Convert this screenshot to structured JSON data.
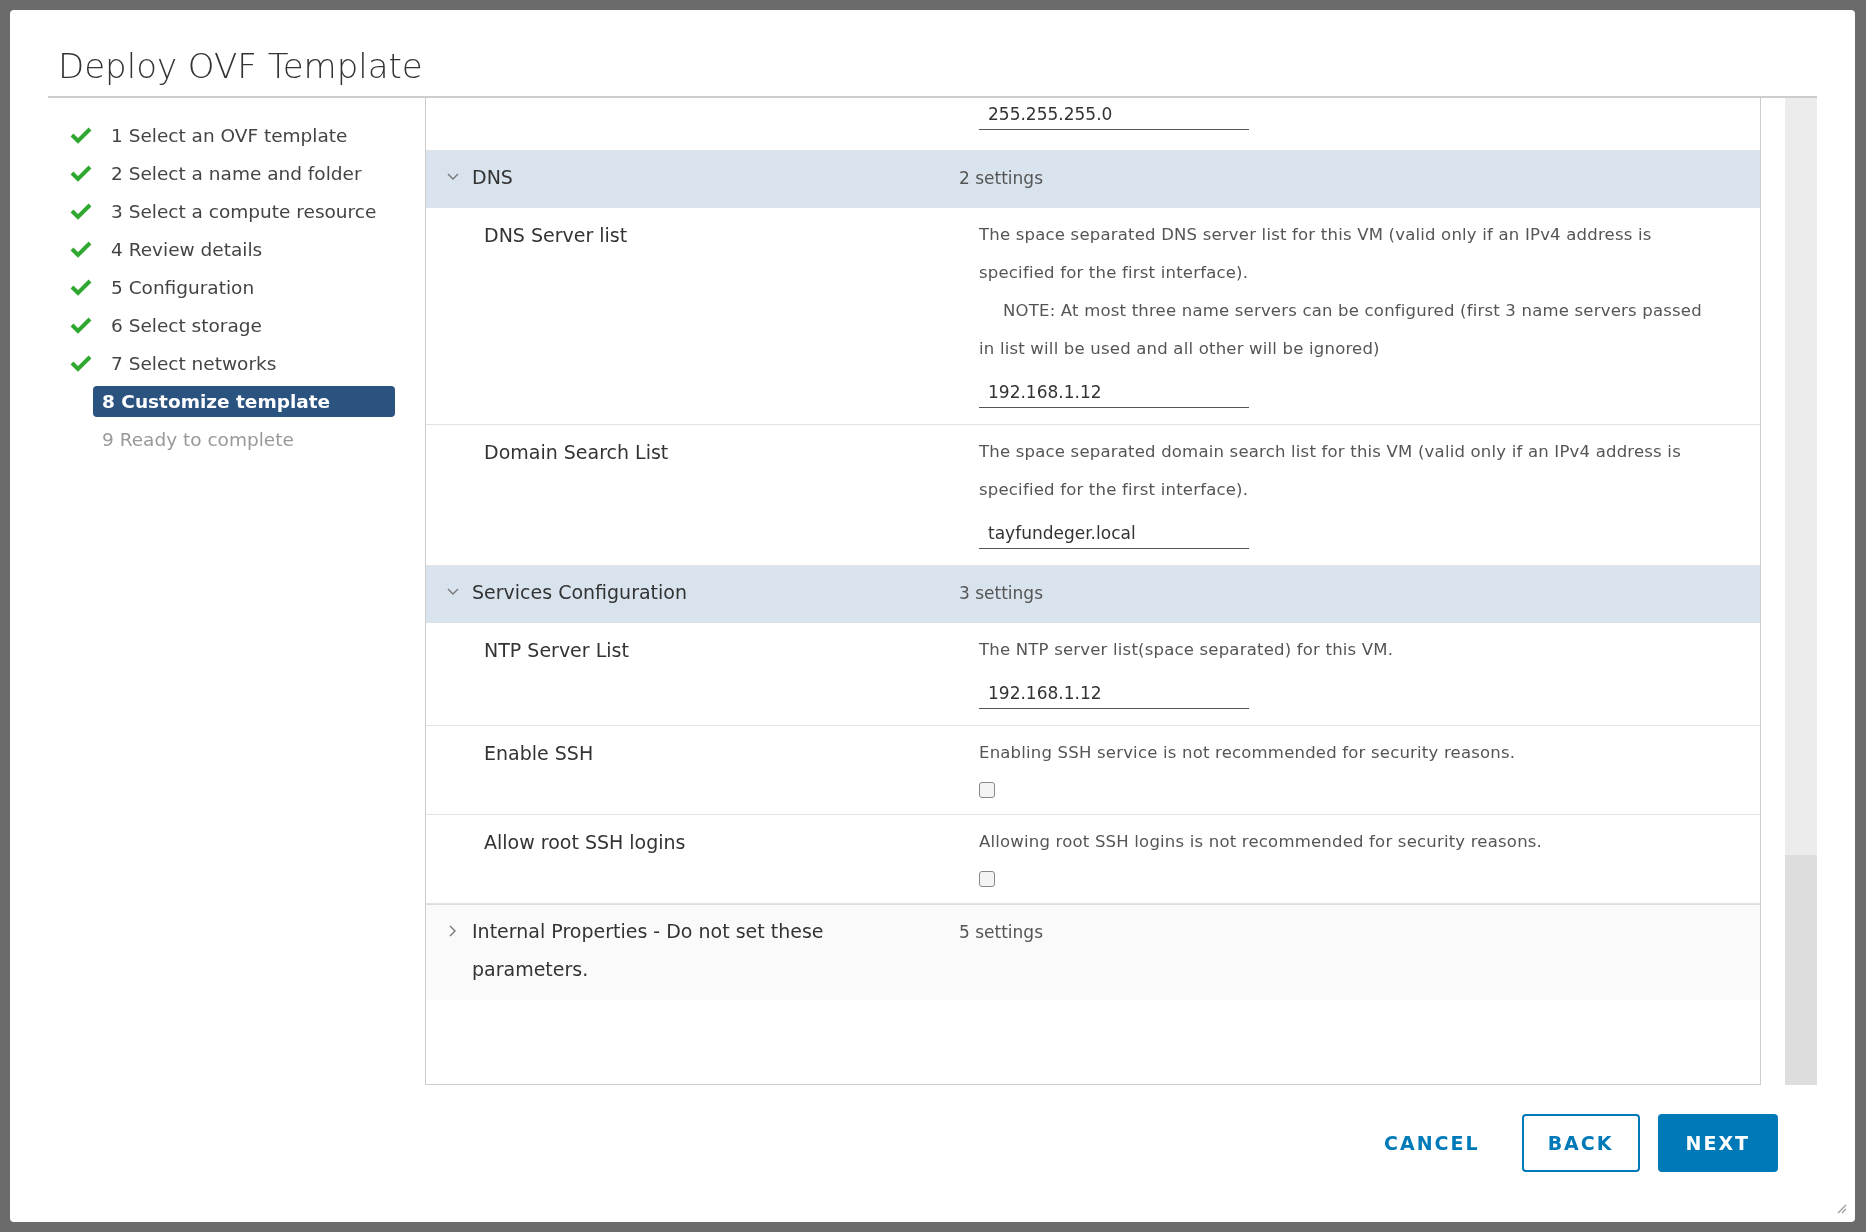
{
  "window": {
    "title": "Deploy OVF Template"
  },
  "steps": [
    {
      "label": "1 Select an OVF template",
      "completed": true,
      "selected": false,
      "disabled": false
    },
    {
      "label": "2 Select a name and folder",
      "completed": true,
      "selected": false,
      "disabled": false
    },
    {
      "label": "3 Select a compute resource",
      "completed": true,
      "selected": false,
      "disabled": false
    },
    {
      "label": "4 Review details",
      "completed": true,
      "selected": false,
      "disabled": false
    },
    {
      "label": "5 Configuration",
      "completed": true,
      "selected": false,
      "disabled": false
    },
    {
      "label": "6 Select storage",
      "completed": true,
      "selected": false,
      "disabled": false
    },
    {
      "label": "7 Select networks",
      "completed": true,
      "selected": false,
      "disabled": false
    },
    {
      "label": "8 Customize template",
      "completed": false,
      "selected": true,
      "disabled": false
    },
    {
      "label": "9 Ready to complete",
      "completed": false,
      "selected": false,
      "disabled": true
    }
  ],
  "top_field": {
    "value": "255.255.255.0"
  },
  "sections": [
    {
      "title": "DNS",
      "count": "2 settings",
      "expanded": true,
      "rows": [
        {
          "kind": "field",
          "label": "DNS Server list",
          "description": [
            "The space separated DNS server list for this VM (valid only if an IPv4 address is specified for the first interface).",
            "NOTE: At most three name servers can be configured (first 3 name servers passed in list will be used and all other will be ignored)"
          ],
          "value": "192.168.1.12"
        },
        {
          "kind": "field",
          "label": "Domain Search List",
          "description": [
            "The space separated domain search list for this VM (valid only if an IPv4 address is specified for the first interface)."
          ],
          "value": "tayfundeger.local"
        }
      ]
    },
    {
      "title": "Services Configuration",
      "count": "3 settings",
      "expanded": true,
      "rows": [
        {
          "kind": "field",
          "label": "NTP Server List",
          "description": [
            "The NTP server list(space separated) for this VM."
          ],
          "value": "192.168.1.12"
        },
        {
          "kind": "checkbox",
          "label": "Enable SSH",
          "description": [
            "Enabling SSH service is not recommended for security reasons."
          ],
          "checked": false
        },
        {
          "kind": "checkbox",
          "label": "Allow root SSH logins",
          "description": [
            "Allowing root SSH logins is not recommended for security reasons."
          ],
          "checked": false
        }
      ]
    },
    {
      "title": "Internal Properties - Do not set these parameters.",
      "count": "5 settings",
      "expanded": false
    }
  ],
  "buttons": [
    {
      "kind": "flat",
      "label": "CANCEL"
    },
    {
      "kind": "outline",
      "label": "BACK"
    },
    {
      "kind": "primary",
      "label": "NEXT"
    }
  ]
}
